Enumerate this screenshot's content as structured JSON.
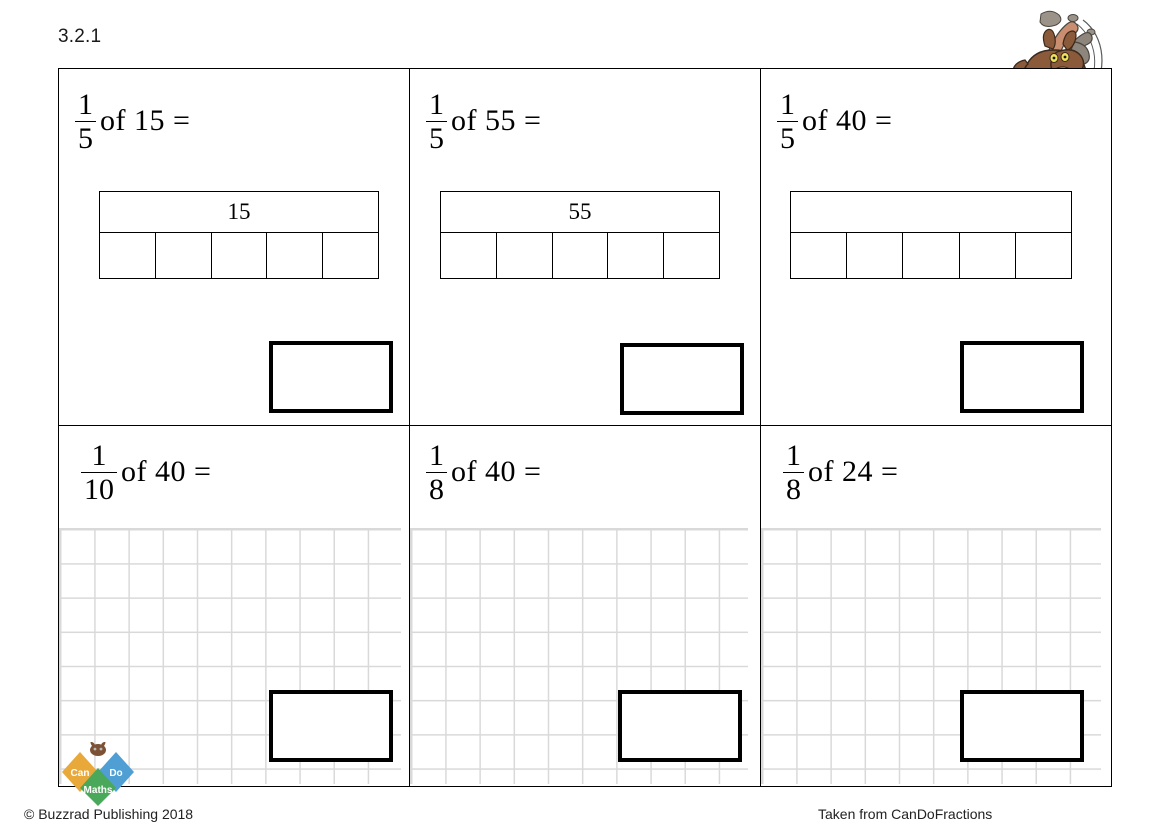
{
  "worksheet": {
    "code": "3.2.1",
    "footer_copyright": "© Buzzrad Publishing 2018",
    "footer_source": "Taken from CanDoFractions"
  },
  "brand": {
    "name": "Can Do Maths",
    "word_left": "Can",
    "word_right": "Do",
    "word_bottom": "Maths",
    "color_left": "#e8a93a",
    "color_right": "#4f9fd4",
    "color_bottom": "#4aa85a",
    "icon": "donkey-logo-icon"
  },
  "illustration": {
    "icon": "kicking-donkey-icon",
    "body_color": "#8a5a3b",
    "rock_color": "#9b9288"
  },
  "questions": [
    {
      "id": "q1",
      "numerator": "1",
      "denominator": "5",
      "text": "of 15 =",
      "model": "bar",
      "whole_label": "15",
      "parts": 5,
      "answer": ""
    },
    {
      "id": "q2",
      "numerator": "1",
      "denominator": "5",
      "text": "of 55 =",
      "model": "bar",
      "whole_label": "55",
      "parts": 5,
      "answer": ""
    },
    {
      "id": "q3",
      "numerator": "1",
      "denominator": "5",
      "text": "of 40 =",
      "model": "bar",
      "whole_label": "",
      "parts": 5,
      "answer": ""
    },
    {
      "id": "q4",
      "numerator": "1",
      "denominator": "10",
      "text": "of 40 =",
      "model": "grid",
      "whole_label": "",
      "parts": 0,
      "answer": ""
    },
    {
      "id": "q5",
      "numerator": "1",
      "denominator": "8",
      "text": "of 40 =",
      "model": "grid",
      "whole_label": "",
      "parts": 0,
      "answer": ""
    },
    {
      "id": "q6",
      "numerator": "1",
      "denominator": "8",
      "text": "of 24 =",
      "model": "grid",
      "whole_label": "",
      "parts": 0,
      "answer": ""
    }
  ]
}
